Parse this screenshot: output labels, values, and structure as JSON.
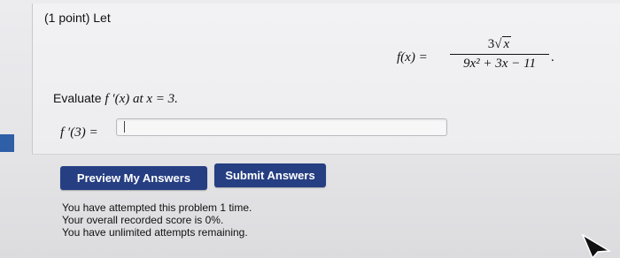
{
  "problem": {
    "points_label": "(1 point) Let",
    "formula": {
      "lhs": "f(x) =",
      "numerator_coefficient": "3",
      "numerator_radicand": "x",
      "denominator": "9x² + 3x − 11",
      "terminator": "."
    },
    "instruction_prefix": "Evaluate",
    "instruction_math": "f ′(x) at x = 3."
  },
  "answer": {
    "label": "f ′(3) =",
    "value": "",
    "placeholder": ""
  },
  "buttons": {
    "preview_label": "Preview My Answers",
    "submit_label": "Submit Answers"
  },
  "status": {
    "attempts": "You have attempted this problem 1 time.",
    "score": "Your overall recorded score is 0%.",
    "remaining": "You have unlimited attempts remaining."
  },
  "colors": {
    "button_bg": "#263e82",
    "button_text": "#ffffff",
    "left_tab": "#2f5fa6"
  },
  "icons": {
    "cursor": "arrow-pointer-icon"
  }
}
